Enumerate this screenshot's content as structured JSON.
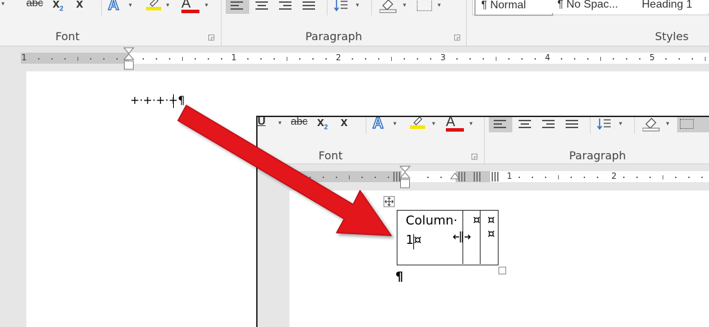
{
  "ribbon": {
    "font_group": {
      "label": "Font",
      "strike_label": "abc",
      "subscript_label": "x",
      "subscript_sub": "2",
      "superscript_label": "x",
      "text_effects_label": "A",
      "font_color_label": "A"
    },
    "paragraph_group": {
      "label": "Paragraph"
    },
    "styles_group": {
      "label": "Styles",
      "items": [
        "¶ Normal",
        "¶ No Spac...",
        "Heading 1"
      ]
    }
  },
  "ruler": {
    "numbers": [
      "1",
      "1",
      "2",
      "3",
      "4",
      "5"
    ]
  },
  "document": {
    "tab_leader_text": "+·+·+·+¶"
  },
  "inset": {
    "ribbon": {
      "underline_label": "U",
      "strike_label": "abc",
      "subscript_label": "x",
      "subscript_sub": "2",
      "superscript_label": "x",
      "text_effects_label": "A",
      "font_color_label": "A",
      "font_label": "Font",
      "paragraph_label": "Paragraph"
    },
    "ruler": {
      "numbers": [
        "1",
        "2"
      ]
    },
    "table": {
      "cell1_line1": "Column·",
      "cell1_line2": "1¤",
      "cell2_mark": "¤",
      "cell3_mark": "¤¤",
      "para_mark": "¶"
    }
  },
  "colors": {
    "accent_arrow": "#e3191f",
    "highlight_yellow": "#f5e600",
    "font_color_red": "#e01010",
    "text_effects_blue": "#2e6fc4"
  }
}
